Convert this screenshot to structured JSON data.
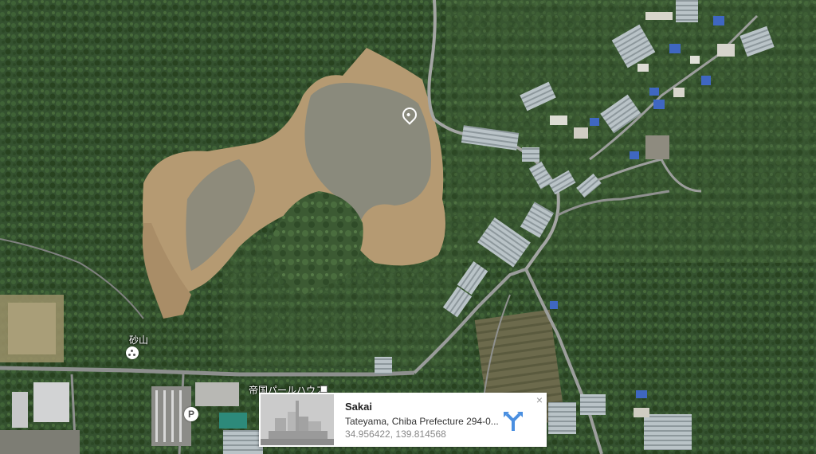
{
  "map": {
    "labels": {
      "sunayama": "砂山",
      "teikoku": "帝国パールハウス"
    },
    "poi_icons": [
      "sunayama-dot-icon",
      "parking-icon",
      "location-pin-icon"
    ],
    "parking_symbol": "P"
  },
  "info_card": {
    "title": "Sakai",
    "address": "Tateyama, Chiba Prefecture 294-0...",
    "coordinates": "34.956422, 139.814568",
    "close_symbol": "×",
    "directions_icon": "directions-icon",
    "thumbnail_icon": "building-thumbnail"
  }
}
